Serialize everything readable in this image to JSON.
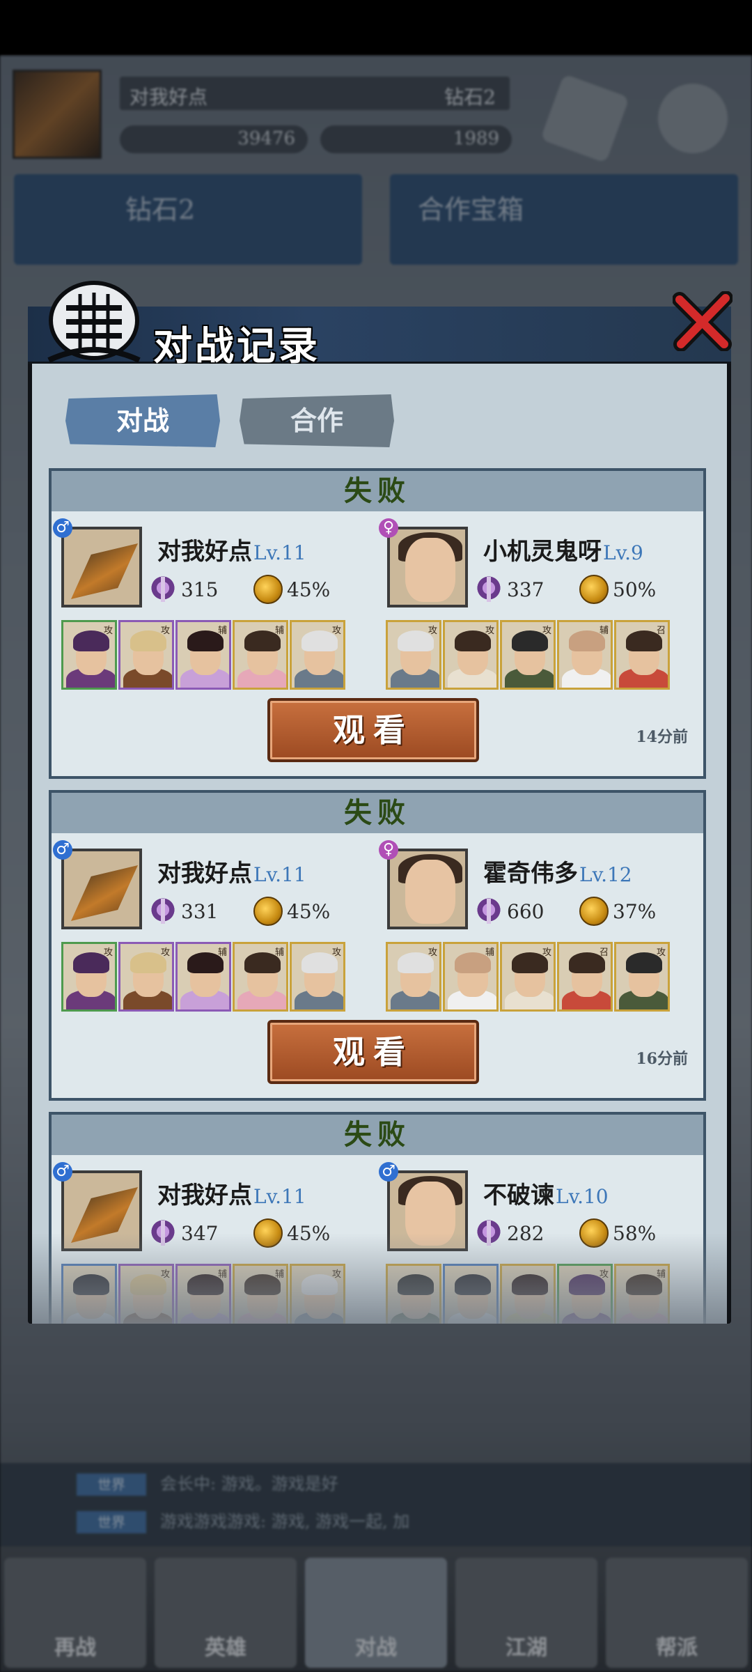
{
  "background": {
    "player_name": "对我好点",
    "rank": "钻石2",
    "resource_1": "39476",
    "resource_2": "1989",
    "card_left_title": "钻石2",
    "card_right_title": "合作宝箱",
    "chat": [
      {
        "tag": "世界",
        "text": "会长中: 游戏。游戏是好"
      },
      {
        "tag": "世界",
        "text": "游戏游戏游戏: 游戏, 游戏一起, 加"
      }
    ],
    "bottom_nav": [
      "再战",
      "英雄",
      "对战",
      "江湖",
      "帮派"
    ]
  },
  "dialog": {
    "title": "对战记录",
    "tabs": [
      "对战",
      "合作"
    ],
    "active_tab": 0,
    "watch_label": "观看"
  },
  "records": [
    {
      "result": "失败",
      "time": "14分前",
      "left": {
        "name": "对我好点",
        "level": "Lv.11",
        "gender": "male",
        "power": "315",
        "winrate": "45%",
        "team": [
          {
            "frame": "green",
            "role": "攻",
            "hair": "#4a2a5a",
            "robe": "#6b3a7a"
          },
          {
            "frame": "purple",
            "role": "攻",
            "hair": "#d8c08a",
            "robe": "#7a4a2a"
          },
          {
            "frame": "purple",
            "role": "辅",
            "hair": "#2a1a1a",
            "robe": "#c8a0d8"
          },
          {
            "frame": "gold",
            "role": "辅",
            "hair": "#3a2a20",
            "robe": "#e6a8b8"
          },
          {
            "frame": "gold",
            "role": "攻",
            "hair": "#e0e0e0",
            "robe": "#6a7a8a"
          }
        ]
      },
      "right": {
        "name": "小机灵鬼呀",
        "level": "Lv.9",
        "gender": "female",
        "power": "337",
        "winrate": "50%",
        "team": [
          {
            "frame": "gold",
            "role": "攻",
            "hair": "#e0e0e0",
            "robe": "#6a7a8a"
          },
          {
            "frame": "gold",
            "role": "攻",
            "hair": "#3a2a20",
            "robe": "#e8e0d0"
          },
          {
            "frame": "gold",
            "role": "攻",
            "hair": "#2a2a2a",
            "robe": "#4a5a3a"
          },
          {
            "frame": "gold",
            "role": "辅",
            "hair": "#c8a080",
            "robe": "#f0f0f0"
          },
          {
            "frame": "gold",
            "role": "召",
            "hair": "#3a2a20",
            "robe": "#c84a3a"
          }
        ]
      }
    },
    {
      "result": "失败",
      "time": "16分前",
      "left": {
        "name": "对我好点",
        "level": "Lv.11",
        "gender": "male",
        "power": "331",
        "winrate": "45%",
        "team": [
          {
            "frame": "green",
            "role": "攻",
            "hair": "#4a2a5a",
            "robe": "#6b3a7a"
          },
          {
            "frame": "purple",
            "role": "攻",
            "hair": "#d8c08a",
            "robe": "#7a4a2a"
          },
          {
            "frame": "purple",
            "role": "辅",
            "hair": "#2a1a1a",
            "robe": "#c8a0d8"
          },
          {
            "frame": "gold",
            "role": "辅",
            "hair": "#3a2a20",
            "robe": "#e6a8b8"
          },
          {
            "frame": "gold",
            "role": "攻",
            "hair": "#e0e0e0",
            "robe": "#6a7a8a"
          }
        ]
      },
      "right": {
        "name": "霍奇伟多",
        "level": "Lv.12",
        "gender": "female",
        "power": "660",
        "winrate": "37%",
        "team": [
          {
            "frame": "gold",
            "role": "攻",
            "hair": "#e0e0e0",
            "robe": "#6a7a8a"
          },
          {
            "frame": "gold",
            "role": "辅",
            "hair": "#c8a080",
            "robe": "#f0f0f0"
          },
          {
            "frame": "gold",
            "role": "攻",
            "hair": "#3a2a20",
            "robe": "#e8e0d0"
          },
          {
            "frame": "gold",
            "role": "召",
            "hair": "#3a2a20",
            "robe": "#c84a3a"
          },
          {
            "frame": "gold",
            "role": "攻",
            "hair": "#2a2a2a",
            "robe": "#4a5a3a"
          }
        ]
      }
    },
    {
      "result": "失败",
      "time": "",
      "left": {
        "name": "对我好点",
        "level": "Lv.11",
        "gender": "male",
        "power": "347",
        "winrate": "45%",
        "team": [
          {
            "frame": "blue",
            "role": "",
            "hair": "#2a2a30",
            "robe": "#e8eef2"
          },
          {
            "frame": "purple",
            "role": "攻",
            "hair": "#d8c08a",
            "robe": "#7a4a2a"
          },
          {
            "frame": "purple",
            "role": "辅",
            "hair": "#2a1a1a",
            "robe": "#c8a0d8"
          },
          {
            "frame": "gold",
            "role": "辅",
            "hair": "#3a2a20",
            "robe": "#e6a8b8"
          },
          {
            "frame": "gold",
            "role": "攻",
            "hair": "#e0e0e0",
            "robe": "#6a7a8a"
          }
        ]
      },
      "right": {
        "name": "不破谏",
        "level": "Lv.10",
        "gender": "male",
        "power": "282",
        "winrate": "58%",
        "team": [
          {
            "frame": "gold",
            "role": "",
            "hair": "#2a2a2a",
            "robe": "#4a5a3a"
          },
          {
            "frame": "blue",
            "role": "",
            "hair": "#2a2a30",
            "robe": "#e8eef2"
          },
          {
            "frame": "gold",
            "role": "",
            "hair": "#2a1a1a",
            "robe": "#e0d080"
          },
          {
            "frame": "green",
            "role": "攻",
            "hair": "#4a2a5a",
            "robe": "#6b3a7a"
          },
          {
            "frame": "gold",
            "role": "辅",
            "hair": "#3a2a20",
            "robe": "#e6a8b8"
          }
        ]
      }
    }
  ]
}
